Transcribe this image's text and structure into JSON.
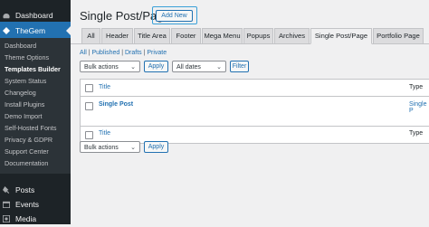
{
  "sidebar": {
    "dashboard": "Dashboard",
    "thegem": "TheGem",
    "submenu": [
      {
        "label": "Dashboard"
      },
      {
        "label": "Theme Options"
      },
      {
        "label": "Templates Builder"
      },
      {
        "label": "System Status"
      },
      {
        "label": "Changelog"
      },
      {
        "label": "Install Plugins"
      },
      {
        "label": "Demo Import"
      },
      {
        "label": "Self-Hosted Fonts"
      },
      {
        "label": "Privacy & GDPR"
      },
      {
        "label": "Support Center"
      },
      {
        "label": "Documentation"
      }
    ],
    "posts": "Posts",
    "events": "Events",
    "media": "Media"
  },
  "header": {
    "title": "Single Post/Page",
    "add_new": "Add New"
  },
  "tabs": [
    "All",
    "Header",
    "Title Area",
    "Footer",
    "Mega Menu",
    "Popups",
    "Archives",
    "Single Post/Page",
    "Portfolio Page"
  ],
  "filters": {
    "all": "All",
    "published": "Published",
    "drafts": "Drafts",
    "private": "Private"
  },
  "bulk_actions": "Bulk actions",
  "apply": "Apply",
  "all_dates": "All dates",
  "filter": "Filter",
  "table": {
    "col_title": "Title",
    "col_type": "Type",
    "row_title": "Single Post",
    "row_type": "Single P"
  },
  "colors": {
    "sidebar_bg": "#1d2327",
    "accent": "#2271b1",
    "highlight_border": "#3aa0d8"
  }
}
